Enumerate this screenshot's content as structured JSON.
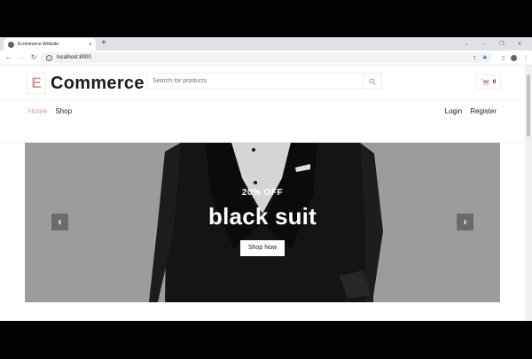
{
  "browser": {
    "tab_title": "Ecommerce Website",
    "tab_close": "×",
    "new_tab": "+",
    "url": "localhost:8000",
    "window_controls": [
      "⌄",
      "–",
      "❐",
      "✕"
    ],
    "nav_back": "←",
    "nav_forward": "→",
    "nav_reload": "↻"
  },
  "header": {
    "logo_letter": "E",
    "logo_text": "Commerce",
    "search_placeholder": "Search for products",
    "cart_count": "0"
  },
  "nav": {
    "items": [
      "Home",
      "Shop"
    ],
    "active": "Home",
    "auth": [
      "Login",
      "Register"
    ]
  },
  "hero": {
    "discount": "20% OFF",
    "headline": "black suit",
    "button": "Shop Now",
    "prev": "‹",
    "next": "›"
  },
  "colors": {
    "accent": "#d19c97",
    "text_dark": "#1c1c1c",
    "hero_bg": "#aaaaad"
  }
}
